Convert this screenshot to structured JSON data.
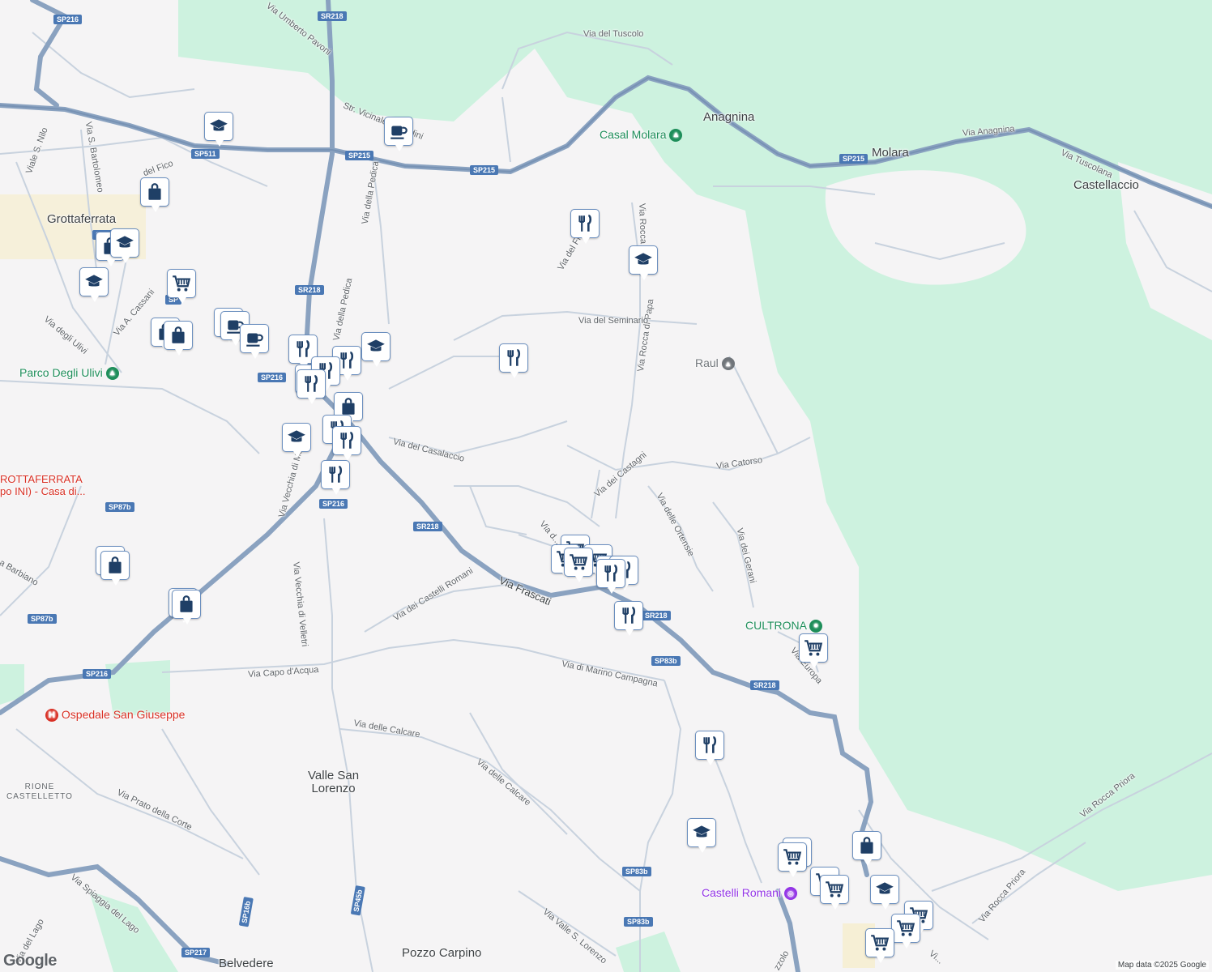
{
  "map": {
    "attribution": "Map data ©2025 Google",
    "logo": "Google",
    "places": [
      {
        "id": "grottaferrata",
        "text": "Grottaferrata"
      },
      {
        "id": "anagnina",
        "text": "Anagnina"
      },
      {
        "id": "molara",
        "text": "Molara"
      },
      {
        "id": "castellaccio",
        "text": "Castellaccio"
      },
      {
        "id": "valle-san-lorenzo",
        "text": "Valle San\nLorenzo"
      },
      {
        "id": "pozzo-carpino",
        "text": "Pozzo Carpino"
      },
      {
        "id": "belvedere",
        "text": "Belvedere"
      },
      {
        "id": "rione-castelletto",
        "text": "RIONE\nCASTELLETTO"
      }
    ],
    "pois": [
      {
        "id": "casal-molara",
        "text": "Casal Molara",
        "kind": "park"
      },
      {
        "id": "parco-degli-ulivi",
        "text": "Parco Degli Ulivi",
        "kind": "park"
      },
      {
        "id": "cultrona",
        "text": "CULTRONA",
        "kind": "park"
      },
      {
        "id": "ospedale",
        "text": "Ospedale San Giuseppe",
        "kind": "hospital"
      },
      {
        "id": "castelli-romani",
        "text": "Castelli Romani",
        "kind": "attraction"
      },
      {
        "id": "raul",
        "text": "Raul",
        "kind": "school"
      },
      {
        "id": "grottaferrata-red",
        "text": "ROTTAFERRATA\npo INI) -  Casa di...",
        "kind": "hospital"
      }
    ],
    "streets": [
      {
        "id": "via-del-tuscolo",
        "text": "Via del Tuscolo"
      },
      {
        "id": "via-anagnina",
        "text": "Via Anagnina"
      },
      {
        "id": "via-tuscolana",
        "text": "Via Tuscolana"
      },
      {
        "id": "via-umberto-pavoni",
        "text": "Via Umberto Pavoni"
      },
      {
        "id": "str-vicinale",
        "text": "Str. Vicinale P...andini"
      },
      {
        "id": "via-della-pedica-1",
        "text": "Via della Pedica"
      },
      {
        "id": "via-della-pedica-2",
        "text": "Via della Pedica"
      },
      {
        "id": "via-del-fico",
        "text": "del Fico"
      },
      {
        "id": "via-s-nilo",
        "text": "Viale S. Nilo"
      },
      {
        "id": "via-s-bartolomeo",
        "text": "Via S. Bartolomeo"
      },
      {
        "id": "via-a-cassani",
        "text": "Via A. Cassani"
      },
      {
        "id": "via-degli-ulivi",
        "text": "Via degli Ulivi"
      },
      {
        "id": "via-del-fra",
        "text": "Via del Fra..."
      },
      {
        "id": "via-rocca-1",
        "text": "Via Rocca"
      },
      {
        "id": "via-rocca-di-papa",
        "text": "Via Rocca di Papa"
      },
      {
        "id": "via-del-seminario",
        "text": "Via del Seminario"
      },
      {
        "id": "via-del-casalaccio",
        "text": "Via del Casalaccio"
      },
      {
        "id": "via-dei-castagni",
        "text": "Via dei Castagni"
      },
      {
        "id": "via-catorso",
        "text": "Via Catorso"
      },
      {
        "id": "via-delle-ortensie",
        "text": "Via delle Ortensie"
      },
      {
        "id": "via-dei-gerani",
        "text": "Via dei Gerani"
      },
      {
        "id": "via-vecchia-di-ma",
        "text": "Via Vecchia di Ma..."
      },
      {
        "id": "via-vecchia-di-velletri",
        "text": "Via Vecchia di Velletri"
      },
      {
        "id": "via-frascati",
        "text": "Via Frascati"
      },
      {
        "id": "via-dei-castelli-romani",
        "text": "Via dei Castelli Romani"
      },
      {
        "id": "via-capo-d-acqua",
        "text": "Via Capo d'Acqua"
      },
      {
        "id": "via-di-marino-campagna",
        "text": "Via di Marino Campagna"
      },
      {
        "id": "via-delle-calcare-1",
        "text": "Via delle Calcare"
      },
      {
        "id": "via-delle-calcare-2",
        "text": "Via delle Calcare"
      },
      {
        "id": "via-barbiano",
        "text": "a Barbiano"
      },
      {
        "id": "via-prato-della-corte",
        "text": "Via Prato della Corte"
      },
      {
        "id": "via-spiaggia-del-lago",
        "text": "Via Spiaggia del Lago"
      },
      {
        "id": "via-del-lago",
        "text": "Via del Lago"
      },
      {
        "id": "via-valle-s-lorenzo",
        "text": "Via Valle S. Lorenzo"
      },
      {
        "id": "via-rocca-priora-1",
        "text": "Via Rocca Priora"
      },
      {
        "id": "via-rocca-priora-2",
        "text": "Via Rocca Priora"
      },
      {
        "id": "via-europa",
        "text": "Via Europa"
      },
      {
        "id": "via-dei-fiori",
        "text": "Via d..."
      },
      {
        "id": "via-vi",
        "text": "Vi..."
      },
      {
        "id": "via-zzolo",
        "text": "zzolo"
      }
    ],
    "shields": [
      "SP216",
      "SR218",
      "SP511",
      "SP215",
      "SP215",
      "SP215",
      "SP21",
      "SR218",
      "SP216",
      "SP",
      "SP216",
      "SP87b",
      "SR218",
      "SP87b",
      "SP216",
      "SR218",
      "SP83b",
      "SR218",
      "SP83b",
      "SP83b",
      "SP217",
      "SP16b",
      "SP45b",
      "SP216",
      "SP216"
    ],
    "pins": [
      {
        "icon": "school-icon"
      },
      {
        "icon": "cafe-icon"
      },
      {
        "icon": "shopping-bag-icon"
      },
      {
        "icon": "shopping-bag-icon"
      },
      {
        "icon": "school-icon"
      },
      {
        "icon": "school-icon"
      },
      {
        "icon": "grocery-cart-icon"
      },
      {
        "icon": "shopping-bag-icon"
      },
      {
        "icon": "shopping-bag-icon"
      },
      {
        "icon": "cafe-icon"
      },
      {
        "icon": "cafe-icon"
      },
      {
        "icon": "cafe-icon"
      },
      {
        "icon": "restaurant-icon"
      },
      {
        "icon": "restaurant-icon"
      },
      {
        "icon": "restaurant-icon"
      },
      {
        "icon": "school-icon"
      },
      {
        "icon": "restaurant-icon"
      },
      {
        "icon": "restaurant-icon"
      },
      {
        "icon": "shopping-bag-icon"
      },
      {
        "icon": "school-icon"
      },
      {
        "icon": "restaurant-icon"
      },
      {
        "icon": "restaurant-icon"
      },
      {
        "icon": "restaurant-icon"
      },
      {
        "icon": "grocery-cart-icon"
      },
      {
        "icon": "restaurant-icon"
      },
      {
        "icon": "school-icon"
      },
      {
        "icon": "restaurant-icon"
      },
      {
        "icon": "shopping-bag-icon"
      },
      {
        "icon": "shopping-bag-icon"
      },
      {
        "icon": "shopping-bag-icon"
      },
      {
        "icon": "shopping-bag-icon"
      },
      {
        "icon": "grocery-cart-icon"
      },
      {
        "icon": "grocery-cart-icon"
      },
      {
        "icon": "grocery-cart-icon"
      },
      {
        "icon": "restaurant-icon"
      },
      {
        "icon": "restaurant-icon"
      },
      {
        "icon": "restaurant-icon"
      },
      {
        "icon": "restaurant-icon"
      },
      {
        "icon": "grocery-cart-icon"
      },
      {
        "icon": "restaurant-icon"
      },
      {
        "icon": "school-icon"
      },
      {
        "icon": "grocery-cart-icon"
      },
      {
        "icon": "grocery-cart-icon"
      },
      {
        "icon": "grocery-cart-icon"
      },
      {
        "icon": "grocery-cart-icon"
      },
      {
        "icon": "shopping-bag-icon"
      },
      {
        "icon": "school-icon"
      },
      {
        "icon": "grocery-cart-icon"
      },
      {
        "icon": "grocery-cart-icon"
      },
      {
        "icon": "grocery-cart-icon"
      }
    ],
    "colors": {
      "background": "#f5f4f5",
      "green_area": "#cdf2df",
      "major_road": "#8aa2c0",
      "road": "#c4cfdc",
      "pin_icon": "#1f3f66",
      "shield": "#4a78b4"
    }
  }
}
